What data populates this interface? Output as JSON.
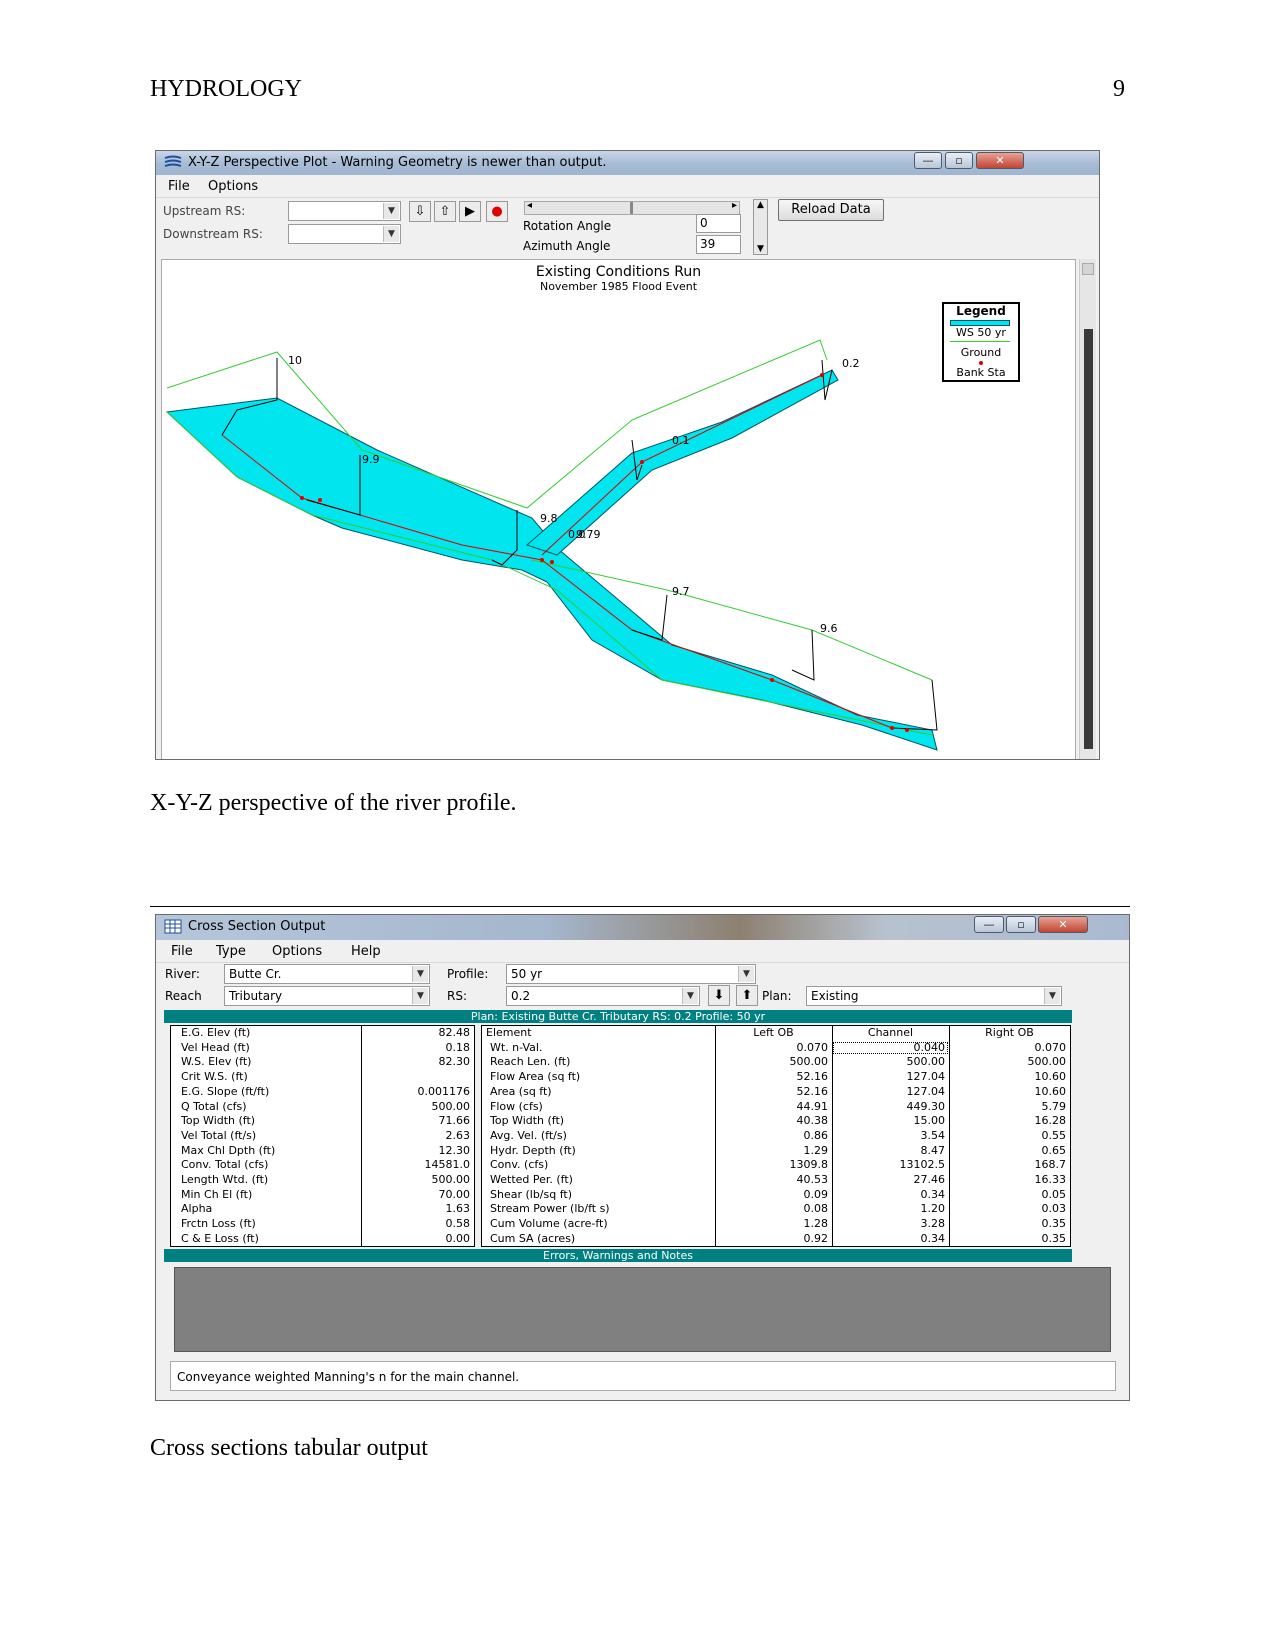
{
  "header": {
    "running_head": "HYDROLOGY",
    "page_number": "9"
  },
  "figure1": {
    "title": "X-Y-Z Perspective Plot - Warning Geometry is newer than output.",
    "menu": [
      "File",
      "Options"
    ],
    "upstream_label": "Upstream RS:",
    "downstream_label": "Downstream RS:",
    "rotation_label": "Rotation Angle",
    "rotation_value": "0",
    "azimuth_label": "Azimuth Angle",
    "azimuth_value": "39",
    "reload_label": "Reload Data",
    "plot_title": "Existing Conditions Run",
    "plot_subtitle": "November 1985 Flood Event",
    "legend": {
      "title": "Legend",
      "items": [
        "WS 50 yr",
        "Ground",
        "Bank Sta"
      ]
    },
    "station_labels": [
      "10",
      "9.9",
      "9.8",
      "9.79",
      "0.1",
      "0.2",
      "9.7",
      "9.6",
      "0.0"
    ],
    "colors": {
      "water": "#00e5ee",
      "ground": "#33cc33",
      "bank": "#dd0000"
    }
  },
  "caption1": "X-Y-Z perspective of the river profile.",
  "figure2": {
    "title": "Cross Section Output",
    "menu": [
      "File",
      "Type",
      "Options",
      "Help"
    ],
    "river_label": "River:",
    "river_value": "Butte Cr.",
    "reach_label": "Reach",
    "reach_value": "Tributary",
    "profile_label": "Profile:",
    "profile_value": "50 yr",
    "rs_label": "RS:",
    "rs_value": "0.2",
    "plan_label": "Plan:",
    "plan_value": "Existing",
    "header_bar": "Plan: Existing     Butte Cr.     Tributary  RS: 0.2     Profile: 50 yr",
    "left_table": [
      [
        "E.G. Elev (ft)",
        "82.48"
      ],
      [
        "Vel Head (ft)",
        "0.18"
      ],
      [
        "W.S. Elev (ft)",
        "82.30"
      ],
      [
        "Crit W.S. (ft)",
        ""
      ],
      [
        "E.G. Slope (ft/ft)",
        "0.001176"
      ],
      [
        "Q Total (cfs)",
        "500.00"
      ],
      [
        "Top Width (ft)",
        "71.66"
      ],
      [
        "Vel Total (ft/s)",
        "2.63"
      ],
      [
        "Max Chl Dpth (ft)",
        "12.30"
      ],
      [
        "Conv. Total (cfs)",
        "14581.0"
      ],
      [
        "Length Wtd. (ft)",
        "500.00"
      ],
      [
        "Min Ch El (ft)",
        "70.00"
      ],
      [
        "Alpha",
        "1.63"
      ],
      [
        "Frctn Loss (ft)",
        "0.58"
      ],
      [
        "C & E Loss (ft)",
        "0.00"
      ]
    ],
    "right_columns": [
      "Element",
      "Left OB",
      "Channel",
      "Right OB"
    ],
    "right_table": [
      [
        "Wt. n-Val.",
        "0.070",
        "0.040",
        "0.070"
      ],
      [
        "Reach Len. (ft)",
        "500.00",
        "500.00",
        "500.00"
      ],
      [
        "Flow Area (sq ft)",
        "52.16",
        "127.04",
        "10.60"
      ],
      [
        "Area (sq ft)",
        "52.16",
        "127.04",
        "10.60"
      ],
      [
        "Flow (cfs)",
        "44.91",
        "449.30",
        "5.79"
      ],
      [
        "Top Width (ft)",
        "40.38",
        "15.00",
        "16.28"
      ],
      [
        "Avg. Vel. (ft/s)",
        "0.86",
        "3.54",
        "0.55"
      ],
      [
        "Hydr. Depth (ft)",
        "1.29",
        "8.47",
        "0.65"
      ],
      [
        "Conv. (cfs)",
        "1309.8",
        "13102.5",
        "168.7"
      ],
      [
        "Wetted Per. (ft)",
        "40.53",
        "27.46",
        "16.33"
      ],
      [
        "Shear (lb/sq ft)",
        "0.09",
        "0.34",
        "0.05"
      ],
      [
        "Stream Power (lb/ft s)",
        "0.08",
        "1.20",
        "0.03"
      ],
      [
        "Cum Volume (acre-ft)",
        "1.28",
        "3.28",
        "0.35"
      ],
      [
        "Cum SA (acres)",
        "0.92",
        "0.34",
        "0.35"
      ]
    ],
    "notes_bar": "Errors, Warnings and Notes",
    "status_text": "Conveyance weighted Manning's n for the main channel."
  },
  "caption2": "Cross sections tabular output"
}
